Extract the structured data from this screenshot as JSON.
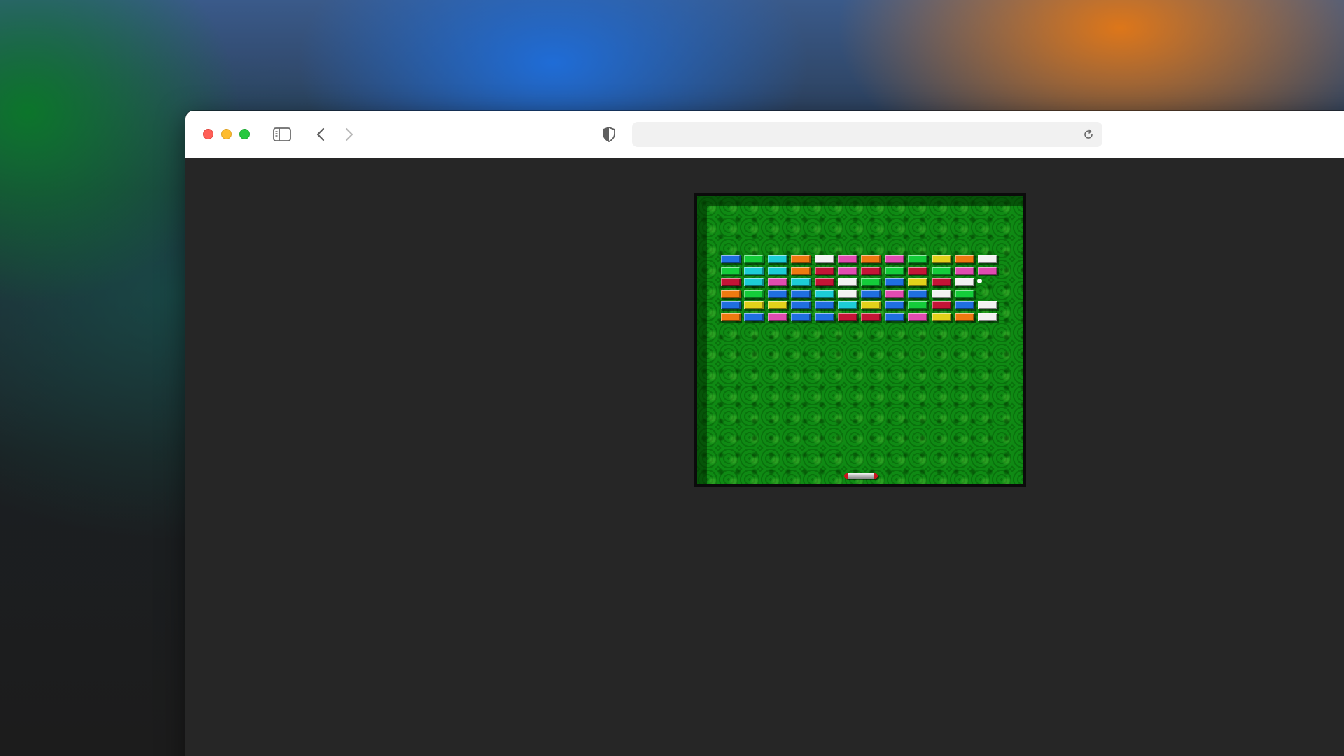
{
  "browser": {
    "url": "",
    "toolbar_icons": {
      "sidebar": "sidebar-toggle-icon",
      "back": "chevron-left-icon",
      "forward": "chevron-right-icon",
      "privacy": "shield-icon",
      "reload": "reload-icon"
    },
    "traffic_lights": [
      "close",
      "minimize",
      "maximize"
    ]
  },
  "game": {
    "playfield_color": "#0f8a14",
    "brick_palette": {
      "B": "#1f6fe0",
      "G": "#14cc3a",
      "C": "#1ccdd6",
      "O": "#ee7a10",
      "W": "#f2f2f2",
      "P": "#e04cb0",
      "R": "#c41436",
      "Y": "#e2d21a"
    },
    "brick_rows": [
      [
        "B",
        "G",
        "C",
        "O",
        "W",
        "P",
        "O",
        "P",
        "G",
        "Y",
        "O",
        "W"
      ],
      [
        "G",
        "C",
        "C",
        "O",
        "R",
        "P",
        "R",
        "G",
        "R",
        "G",
        "P",
        "P"
      ],
      [
        "R",
        "C",
        "P",
        "C",
        "R",
        "W",
        "G",
        "B",
        "Y",
        "R",
        "W",
        ""
      ],
      [
        "O",
        "G",
        "B",
        "B",
        "C",
        "W",
        "B",
        "P",
        "B",
        "W",
        "G",
        ""
      ],
      [
        "B",
        "Y",
        "Y",
        "B",
        "B",
        "C",
        "Y",
        "B",
        "G",
        "R",
        "B",
        "W"
      ],
      [
        "O",
        "B",
        "P",
        "B",
        "B",
        "R",
        "R",
        "B",
        "P",
        "Y",
        "O",
        "W"
      ]
    ],
    "ball": {
      "color": "#ffffff"
    },
    "paddle": {
      "color": "#c0c0c0",
      "cap_color": "#c8141e"
    }
  }
}
